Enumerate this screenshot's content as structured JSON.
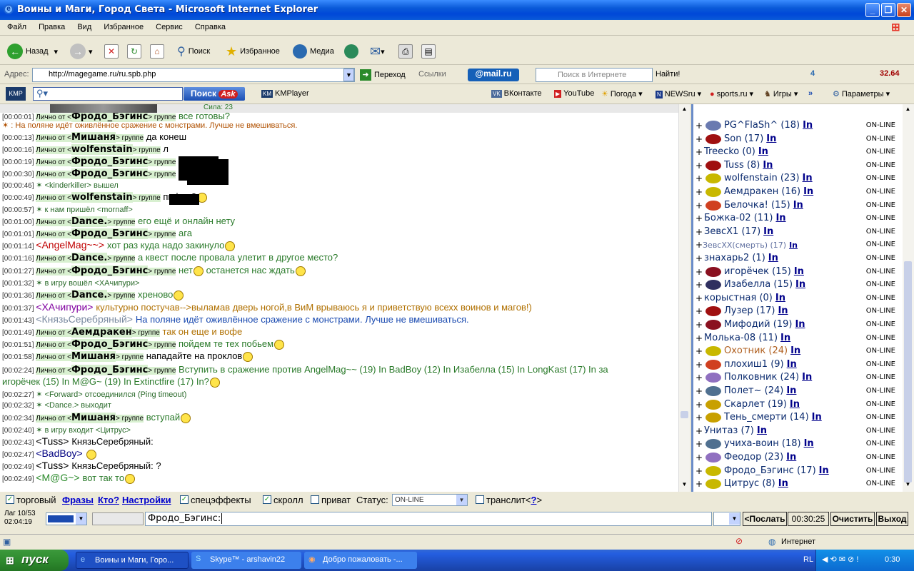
{
  "window": {
    "title": "Воины и Маги, Город Света - Microsoft Internet Explorer"
  },
  "menu": [
    "Файл",
    "Правка",
    "Вид",
    "Избранное",
    "Сервис",
    "Справка"
  ],
  "toolbar": {
    "back": "Назад",
    "search": "Поиск",
    "favorites": "Избранное",
    "media": "Медиа"
  },
  "address": {
    "label": "Адрес:",
    "url": "http://magegame.ru/ru.spb.php",
    "go": "Переход",
    "links": "Ссылки",
    "mail": "@mail.ru",
    "search_placeholder": "Поиск в Интернете",
    "find": "Найти!",
    "counter": "4",
    "price": "32.64"
  },
  "links": {
    "search_btn": "Поиск",
    "ask": "Ask",
    "kmplayer": "KMPlayer",
    "vk": "ВКонтакте",
    "youtube": "YouTube",
    "weather": "Погода",
    "newsru": "NEWSru",
    "sports": "sports.ru",
    "games": "Игры",
    "params": "Параметры"
  },
  "banner": {
    "strength": "Сила: 23"
  },
  "chat": [
    {
      "ts": "[00:00:01]",
      "label": "Лично от <",
      "nick": "Фродо_Бэгинс",
      "group": "> группе",
      "msg": "все готовы?",
      "cls": "g"
    },
    {
      "sys": "✶ : На поляне идёт оживлённое сражение с монстрами. Лучше не вмешиваться."
    },
    {
      "ts": "[00:00:13]",
      "label": "Лично от <",
      "nick": "Мишаня",
      "group": "> группе",
      "msg": "да конеш"
    },
    {
      "ts": "[00:00:16]",
      "label": "Лично от <",
      "nick": "wolfenstain",
      "group": "> группе",
      "msg": "л"
    },
    {
      "ts": "[00:00:19]",
      "label": "Лично от <",
      "nick": "Фродо_Бэгинс",
      "group": "> группе",
      "msg": ""
    },
    {
      "ts": "[00:00:30]",
      "label": "Лично от <",
      "nick": "Фродо_Бэгинс",
      "group": "> группе",
      "msg": ""
    },
    {
      "ts": "[00:00:46]",
      "sys": "✶ <kinderkiller> вышел"
    },
    {
      "ts": "[00:00:49]",
      "label": "Лично от <",
      "nick": "wolfenstain",
      "group": "> группе",
      "msg": "пифон?",
      "smile": true
    },
    {
      "ts": "[00:00:57]",
      "sys": "✶ к нам пришёл <mornaff>"
    },
    {
      "ts": "[00:01:00]",
      "label": "Лично от <",
      "nick": "Dance.",
      "group": "> группе",
      "msg": "его ещё и онлайн нету",
      "cls": "g"
    },
    {
      "ts": "[00:01:01]",
      "label": "Лично от <",
      "nick": "Фродо_Бэгинс",
      "group": "> группе",
      "msg": "ага",
      "cls": "g"
    },
    {
      "ts": "[00:01:14]",
      "plain": "<AngelMag~~>",
      "pcol": "#c00000",
      "msg": "хот раз куда надо закинуло",
      "cls": "g",
      "smile": true
    },
    {
      "ts": "[00:01:16]",
      "label": "Лично от <",
      "nick": "Dance.",
      "group": "> группе",
      "msg": "а квест после провала улетит в другое место?",
      "cls": "g"
    },
    {
      "ts": "[00:01:27]",
      "label": "Лично от <",
      "nick": "Фродо_Бэгинс",
      "group": "> группе",
      "msg": "нет",
      "cls": "g",
      "smile": true,
      "msg2": "останется нас ждать"
    },
    {
      "ts": "[00:01:32]",
      "sys": "✶ в игру вошёл <ХАчипури>"
    },
    {
      "ts": "[00:01:36]",
      "label": "Лично от <",
      "nick": "Dance.",
      "group": "> группе",
      "msg": "хреново",
      "cls": "g",
      "smile": true
    },
    {
      "ts": "[00:01:37]",
      "plain": "<ХАчипури>",
      "pcol": "#8000a0",
      "msg": "культурно постучав-->выламав дверь ногой,в ВиМ врываюсь я и приветствую всехх воинов и магов!)",
      "cls": "o"
    },
    {
      "ts": "[00:01:43]",
      "plain": "<КнязьСеребряный>",
      "pcol": "#7a8aa0",
      "msg": "На поляне идёт оживлённое сражение с монстрами. Лучше не вмешиваться.",
      "cls": "b"
    },
    {
      "ts": "[00:01:49]",
      "label": "Лично от <",
      "nick": "Аемдракен",
      "group": "> группе",
      "msg": "так он еще и вофе",
      "cls": "o"
    },
    {
      "ts": "[00:01:51]",
      "label": "Лично от <",
      "nick": "Фродо_Бэгинс",
      "group": "> группе",
      "msg": "пойдем те тех побьем",
      "cls": "g",
      "smile": true
    },
    {
      "ts": "[00:01:58]",
      "label": "Лично от <",
      "nick": "Мишаня",
      "group": "> группе",
      "msg": "нападайте на проклов",
      "smile": true
    },
    {
      "ts": "[00:02:24]",
      "label": "Лично от <",
      "nick": "Фродо_Бэгинс",
      "group": "> группе",
      "msg": "Вступить в сражение против AngelMag~~ (19) In BadBoy (12) In Изабелла (15) In LongKast (17) In за",
      "cls": "g"
    },
    {
      "cont": "игорёчек (15) In M@G~ (19) In Extinctfire (17) In?",
      "smile": true
    },
    {
      "ts": "[00:02:27]",
      "sys": "✶ <Forward> отсоединился (Ping timeout)"
    },
    {
      "ts": "[00:02:32]",
      "sys": "✶ <Dance.> выходит"
    },
    {
      "ts": "[00:02:34]",
      "label": "Лично от <",
      "nick": "Мишаня",
      "group": "> группе",
      "msg": "вступай",
      "cls": "g",
      "smile": true
    },
    {
      "ts": "[00:02:40]",
      "sys": "✶ в игру входит <Цитрус>"
    },
    {
      "ts": "[00:02:43]",
      "plain": "<Tuss>",
      "pcol": "#000",
      "msg": "КнязьСеребряный:"
    },
    {
      "ts": "[00:02:47]",
      "plain": "<BadBoy>",
      "pcol": "#000080",
      "msg": "",
      "smile": true
    },
    {
      "ts": "[00:02:49]",
      "plain": "<Tuss>",
      "pcol": "#000",
      "msg": "КнязьСеребряный: ?"
    },
    {
      "ts": "[00:02:49]",
      "plain": "<M@G~>",
      "pcol": "#2a8a2a",
      "msg": "вот так то",
      "cls": "g",
      "smile": true
    }
  ],
  "users": [
    {
      "name": "PG^FlaSh^ (18)",
      "in": "In",
      "status": "ON-LINE",
      "ic": "#6a7ab0"
    },
    {
      "name": "Son (17)",
      "in": "In",
      "status": "ON-LINE",
      "ic": "#a01010"
    },
    {
      "name": "Treecko (0)",
      "in": "In",
      "status": "ON-LINE",
      "ic": ""
    },
    {
      "name": "Tuss (8)",
      "in": "In",
      "status": "ON-LINE",
      "ic": "#a01010"
    },
    {
      "name": "wolfenstain (23)",
      "in": "In",
      "status": "ON-LINE",
      "ic": "#c8b800"
    },
    {
      "name": "Аемдракен (16)",
      "in": "In",
      "status": "ON-LINE",
      "ic": "#c8b800"
    },
    {
      "name": "Белочка! (15)",
      "in": "In",
      "status": "ON-LINE",
      "ic": "#d04020"
    },
    {
      "name": "Божка-02 (11)",
      "in": "In",
      "status": "ON-LINE",
      "ic": ""
    },
    {
      "name": "ЗевсХ1 (17)",
      "in": "In",
      "status": "ON-LINE",
      "ic": ""
    },
    {
      "name": "ЗевсХХ(смерть) (17)",
      "in": "In",
      "status": "ON-LINE",
      "ic": "",
      "light": true
    },
    {
      "name": "знахарь2 (1)",
      "in": "In",
      "status": "ON-LINE",
      "ic": ""
    },
    {
      "name": "игорёчек (15)",
      "in": "In",
      "status": "ON-LINE",
      "ic": "#8a1020"
    },
    {
      "name": "Изабелла (15)",
      "in": "In",
      "status": "ON-LINE",
      "ic": "#303060"
    },
    {
      "name": "корыстная (0)",
      "in": "In",
      "status": "ON-LINE",
      "ic": ""
    },
    {
      "name": "Лузер (17)",
      "in": "In",
      "status": "ON-LINE",
      "ic": "#a01010"
    },
    {
      "name": "Мифодий (19)",
      "in": "In",
      "status": "ON-LINE",
      "ic": "#8a1020"
    },
    {
      "name": "Молька-08 (11)",
      "in": "In",
      "status": "ON-LINE",
      "ic": ""
    },
    {
      "name": "Охотник (24)",
      "in": "In",
      "status": "ON-LINE",
      "ic": "#c8b800",
      "brown": true
    },
    {
      "name": "плохиш1 (9)",
      "in": "In",
      "status": "ON-LINE",
      "ic": "#d04020"
    },
    {
      "name": "Полковник (24)",
      "in": "In",
      "status": "ON-LINE",
      "ic": "#9070c0"
    },
    {
      "name": "Полет~ (24)",
      "in": "In",
      "status": "ON-LINE",
      "ic": "#507090"
    },
    {
      "name": "Скарлет (19)",
      "in": "In",
      "status": "ON-LINE",
      "ic": "#c8a000"
    },
    {
      "name": "Тень_смерти (14)",
      "in": "In",
      "status": "ON-LINE",
      "ic": "#c8a000"
    },
    {
      "name": "Унитаз (7)",
      "in": "In",
      "status": "ON-LINE",
      "ic": ""
    },
    {
      "name": "учиха-воин (18)",
      "in": "In",
      "status": "ON-LINE",
      "ic": "#507090"
    },
    {
      "name": "Феодор (23)",
      "in": "In",
      "status": "ON-LINE",
      "ic": "#9070c0"
    },
    {
      "name": "Фродо_Бэгинс (17)",
      "in": "In",
      "status": "ON-LINE",
      "ic": "#c8b800"
    },
    {
      "name": "Цитрус (8)",
      "in": "In",
      "status": "ON-LINE",
      "ic": "#c8b800"
    }
  ],
  "controls": {
    "trade": "торговый",
    "phrases": "Фразы",
    "who": "Кто?",
    "settings": "Настройки",
    "effects": "спецэффекты",
    "scroll": "скролл",
    "private": "приват",
    "status_label": "Статус:",
    "status_value": "ON-LINE",
    "translit": "транслит",
    "translit_help": "?",
    "lag": "Лаг 10/53",
    "clock": "02:04:19",
    "input_value": "Фродо_Бэгинс: ",
    "send": "<Послать",
    "timer": "00:30:25",
    "clear": "Очистить",
    "exit": "Выход"
  },
  "statusbar": {
    "zone": "Интернет"
  },
  "taskbar": {
    "start": "пуск",
    "tasks": [
      "Воины и Маги, Горо...",
      "Skype™ - arshavin22",
      "Добро пожаловать -..."
    ],
    "lang": "RL",
    "time": "0:30"
  }
}
